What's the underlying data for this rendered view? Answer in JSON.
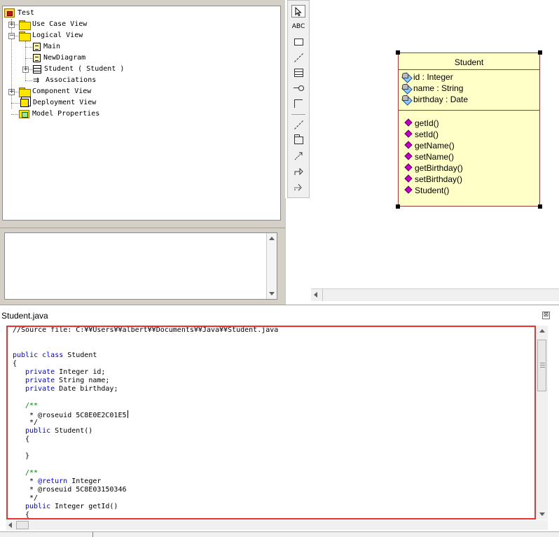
{
  "browser": {
    "root": "Test",
    "items": [
      {
        "label": "Use Case View"
      },
      {
        "label": "Logical View"
      },
      {
        "label": "Main"
      },
      {
        "label": "NewDiagram"
      },
      {
        "label": "Student ( Student )"
      },
      {
        "label": "Associations"
      },
      {
        "label": "Component View"
      },
      {
        "label": "Deployment View"
      },
      {
        "label": "Model Properties"
      }
    ]
  },
  "toolbox": {
    "text_tool": "ABC"
  },
  "diagram": {
    "class_name": "Student",
    "attributes": [
      "id : Integer",
      "name : String",
      "birthday : Date"
    ],
    "operations": [
      "getId()",
      "setId()",
      "getName()",
      "setName()",
      "getBirthday()",
      "setBirthday()",
      "Student()"
    ]
  },
  "editor": {
    "title": "Student.java",
    "close_glyph": "⊠",
    "code": {
      "l0": "//Source file: C:¥¥Users¥¥albert¥¥Documents¥¥Java¥¥Student.java",
      "l3_kw": "public class",
      "l3_rest": " Student",
      "l4": "{",
      "l5_kw": "private",
      "l5_rest": " Integer id;",
      "l6_kw": "private",
      "l6_rest": " String name;",
      "l7_kw": "private",
      "l7_rest": " Date birthday;",
      "l9": "/**",
      "l10": " * @roseuid 5C8E0E2C01E5",
      "l11": " */",
      "l12_kw": "public",
      "l12_rest": " Student()",
      "l13": "{",
      "l15": "}",
      "l17": "/**",
      "l18_pre": " * ",
      "l18_tag": "@return",
      "l18_rest": " Integer",
      "l19": " * @roseuid 5C8E03150346",
      "l20": " */",
      "l21_kw": "public",
      "l21_rest": " Integer getId()",
      "l22": "{"
    }
  }
}
